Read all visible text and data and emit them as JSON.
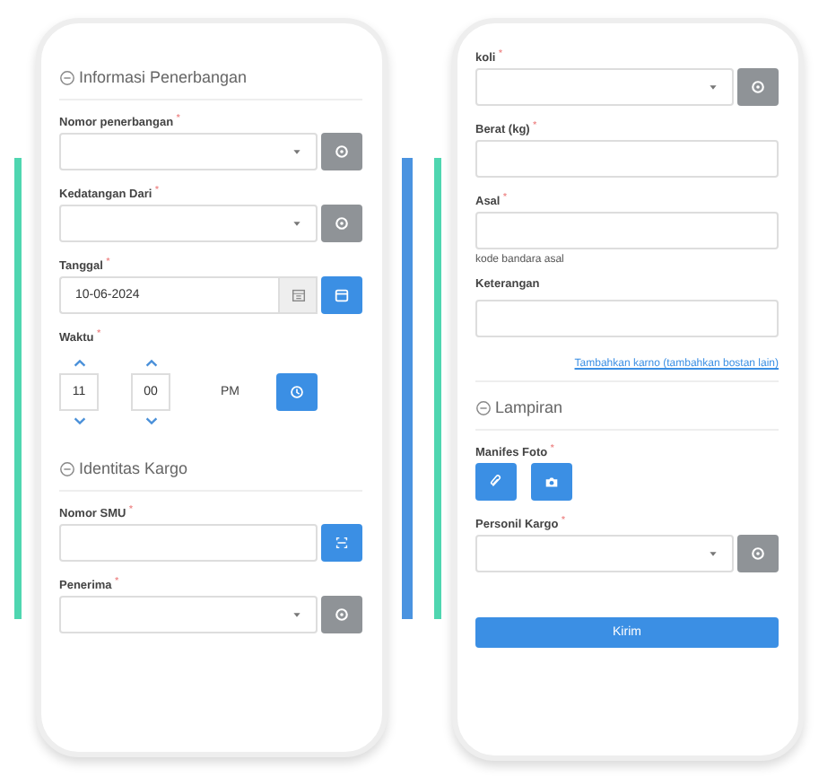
{
  "screens": [
    {
      "items": [
        {
          "kind": "section",
          "title": "Informasi Penerbangan"
        },
        {
          "kind": "select",
          "label": "Nomor penerbangan $^{*}$"
        },
        {
          "kind": "select",
          "label": "Kedatangan Dari $^{*}$"
        },
        {
          "kind": "date",
          "label": "Tanggal $^{*}$",
          "value": "10-06-2024"
        },
        {
          "kind": "time",
          "label": "Waktu $^{*}$",
          "hour": "11",
          "minute": "00",
          "meridian": "PM"
        },
        {
          "kind": "section",
          "title": "Identitas Kargo"
        },
        {
          "kind": "scan",
          "label": "Nomor SMU $^{*}$"
        },
        {
          "kind": "select",
          "label": "Penerima $^{*}$"
        }
      ]
    },
    {
      "items": [
        {
          "kind": "select",
          "label": "koli $^{*}$"
        },
        {
          "kind": "input",
          "label": "Berat (kg) $^{*}$"
        },
        {
          "kind": "input",
          "label": "Asal $^{*}$",
          "hint": "kode bandara asal"
        },
        {
          "kind": "input",
          "label": "Keterangan"
        },
        {
          "kind": "link",
          "text": "Tambahkan karno (tambahkan bostan lain)"
        },
        {
          "kind": "section",
          "title": "Lampiran"
        },
        {
          "kind": "photo",
          "label": "Manifes Foto $^{*}$"
        },
        {
          "kind": "select",
          "label": "Personil Kargo $^{*}$"
        },
        {
          "kind": "submit",
          "text": "Kirim"
        }
      ]
    }
  ]
}
